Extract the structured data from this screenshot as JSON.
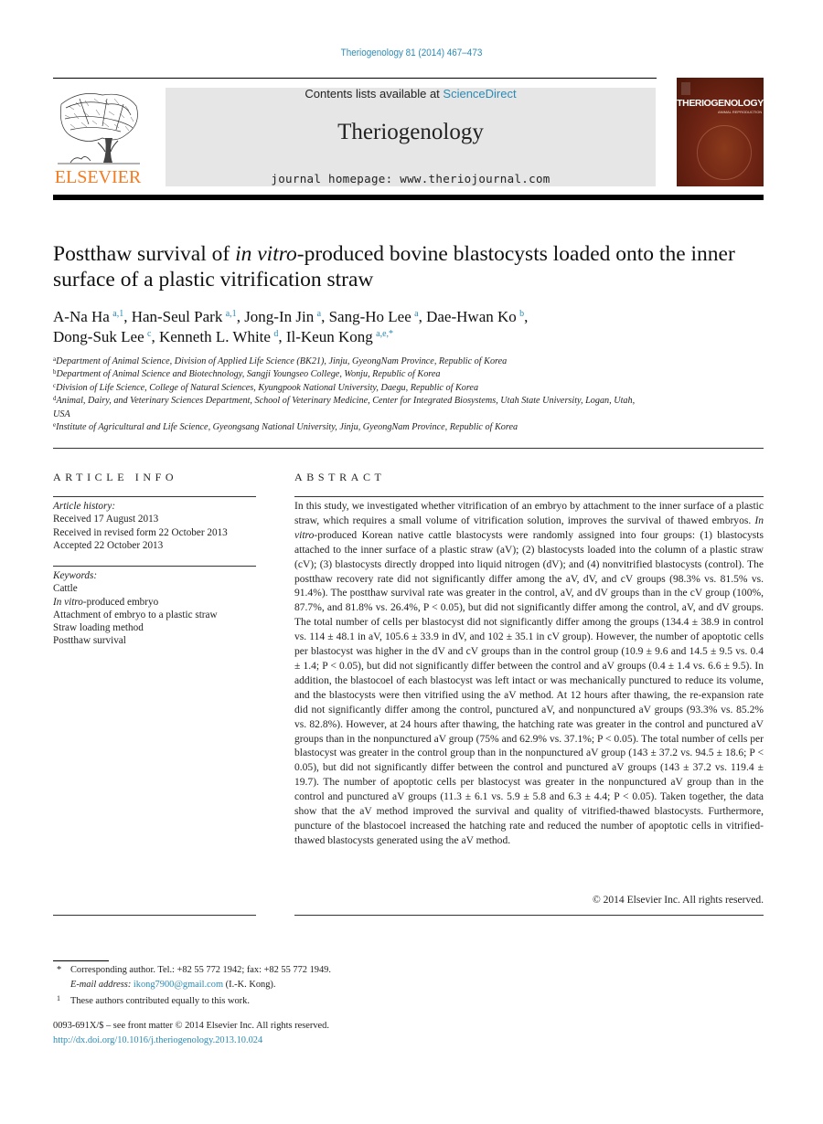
{
  "header": {
    "journal_ref": "Theriogenology 81 (2014) 467–473",
    "contents_prefix": "Contents lists available at ",
    "contents_link": "ScienceDirect",
    "journal_name": "Theriogenology",
    "homepage": "journal homepage: www.theriojournal.com",
    "publisher_logo_text": "ELSEVIER",
    "cover_title": "THERIOGENOLOGY",
    "cover_subtitle": "ANIMAL REPRODUCTION",
    "colors": {
      "link": "#2a8bb5",
      "elsevier_orange": "#f47b20",
      "banner_bg": "#e6e6e6"
    }
  },
  "article": {
    "title_part1": "Postthaw survival of ",
    "title_italic": "in vitro",
    "title_part2": "-produced bovine blastocysts loaded onto the inner surface of a plastic vitrification straw",
    "authors": [
      {
        "name": "A-Na Ha",
        "sup": "a,1",
        "sep": ", "
      },
      {
        "name": "Han-Seul Park",
        "sup": "a,1",
        "sep": ", "
      },
      {
        "name": "Jong-In Jin",
        "sup": "a",
        "sep": ", "
      },
      {
        "name": "Sang-Ho Lee",
        "sup": "a",
        "sep": ", "
      },
      {
        "name": "Dae-Hwan Ko",
        "sup": "b",
        "sep": ","
      },
      {
        "name": "Dong-Suk Lee",
        "sup": "c",
        "sep": ", "
      },
      {
        "name": "Kenneth L. White",
        "sup": "d",
        "sep": ", "
      },
      {
        "name": "Il-Keun Kong",
        "sup": "a,e,*",
        "sep": ""
      }
    ],
    "affiliations": [
      {
        "key": "a",
        "text": "Department of Animal Science, Division of Applied Life Science (BK21), Jinju, GyeongNam Province, Republic of Korea"
      },
      {
        "key": "b",
        "text": "Department of Animal Science and Biotechnology, Sangji Youngseo College, Wonju, Republic of Korea"
      },
      {
        "key": "c",
        "text": "Division of Life Science, College of Natural Sciences, Kyungpook National University, Daegu, Republic of Korea"
      },
      {
        "key": "d",
        "text": "Animal, Dairy, and Veterinary Sciences Department, School of Veterinary Medicine, Center for Integrated Biosystems, Utah State University, Logan, Utah, USA"
      },
      {
        "key": "e",
        "text": "Institute of Agricultural and Life Science, Gyeongsang National University, Jinju, GyeongNam Province, Republic of Korea"
      }
    ]
  },
  "article_info": {
    "heading": "ARTICLE INFO",
    "history_label": "Article history:",
    "history": [
      "Received 17 August 2013",
      "Received in revised form 22 October 2013",
      "Accepted 22 October 2013"
    ],
    "keywords_label": "Keywords:",
    "keywords": [
      {
        "italic": "",
        "text": "Cattle"
      },
      {
        "italic": "In vitro",
        "text": "-produced embryo"
      },
      {
        "italic": "",
        "text": "Attachment of embryo to a plastic straw"
      },
      {
        "italic": "",
        "text": "Straw loading method"
      },
      {
        "italic": "",
        "text": "Postthaw survival"
      }
    ]
  },
  "abstract": {
    "heading": "ABSTRACT",
    "text_part1": "In this study, we investigated whether vitrification of an embryo by attachment to the inner surface of a plastic straw, which requires a small volume of vitrification solution, improves the survival of thawed embryos. ",
    "text_italic": "In vitro",
    "text_part2": "-produced Korean native cattle blastocysts were randomly assigned into four groups: (1) blastocysts attached to the inner surface of a plastic straw (aV); (2) blastocysts loaded into the column of a plastic straw (cV); (3) blastocysts directly dropped into liquid nitrogen (dV); and (4) nonvitrified blastocysts (control). The postthaw recovery rate did not significantly differ among the aV, dV, and cV groups (98.3% vs. 81.5% vs. 91.4%). The postthaw survival rate was greater in the control, aV, and dV groups than in the cV group (100%, 87.7%, and 81.8% vs. 26.4%, P < 0.05), but did not significantly differ among the control, aV, and dV groups. The total number of cells per blastocyst did not significantly differ among the groups (134.4 ± 38.9 in control vs. 114 ± 48.1 in aV, 105.6 ± 33.9 in dV, and 102 ± 35.1 in cV group). However, the number of apoptotic cells per blastocyst was higher in the dV and cV groups than in the control group (10.9 ± 9.6 and 14.5 ± 9.5 vs. 0.4 ± 1.4; P < 0.05), but did not significantly differ between the control and aV groups (0.4 ± 1.4 vs. 6.6 ± 9.5). In addition, the blastocoel of each blastocyst was left intact or was mechanically punctured to reduce its volume, and the blastocysts were then vitrified using the aV method. At 12 hours after thawing, the re-expansion rate did not significantly differ among the control, punctured aV, and nonpunctured aV groups (93.3% vs. 85.2% vs. 82.8%). However, at 24 hours after thawing, the hatching rate was greater in the control and punctured aV groups than in the nonpunctured aV group (75% and 62.9% vs. 37.1%; P < 0.05). The total number of cells per blastocyst was greater in the control group than in the nonpunctured aV group (143 ± 37.2 vs. 94.5 ± 18.6; P < 0.05), but did not significantly differ between the control and punctured aV groups (143 ± 37.2 vs. 119.4 ± 19.7). The number of apoptotic cells per blastocyst was greater in the nonpunctured aV group than in the control and punctured aV groups (11.3 ± 6.1 vs. 5.9 ± 5.8 and 6.3 ± 4.4; P < 0.05). Taken together, the data show that the aV method improved the survival and quality of vitrified-thawed blastocysts. Furthermore, puncture of the blastocoel increased the hatching rate and reduced the number of apoptotic cells in vitrified-thawed blastocysts generated using the aV method.",
    "copyright": "© 2014 Elsevier Inc. All rights reserved."
  },
  "footnotes": {
    "corresponding_mark": "*",
    "corresponding_text": "Corresponding author. Tel.: +82 55 772 1942; fax: +82 55 772 1949.",
    "email_label": "E-mail address:",
    "email": "ikong7900@gmail.com",
    "email_suffix": " (I.-K. Kong).",
    "equal_mark": "1",
    "equal_text": "These authors contributed equally to this work."
  },
  "front_matter": {
    "issn_line": "0093-691X/$ – see front matter © 2014 Elsevier Inc. All rights reserved.",
    "doi": "http://dx.doi.org/10.1016/j.theriogenology.2013.10.024"
  }
}
